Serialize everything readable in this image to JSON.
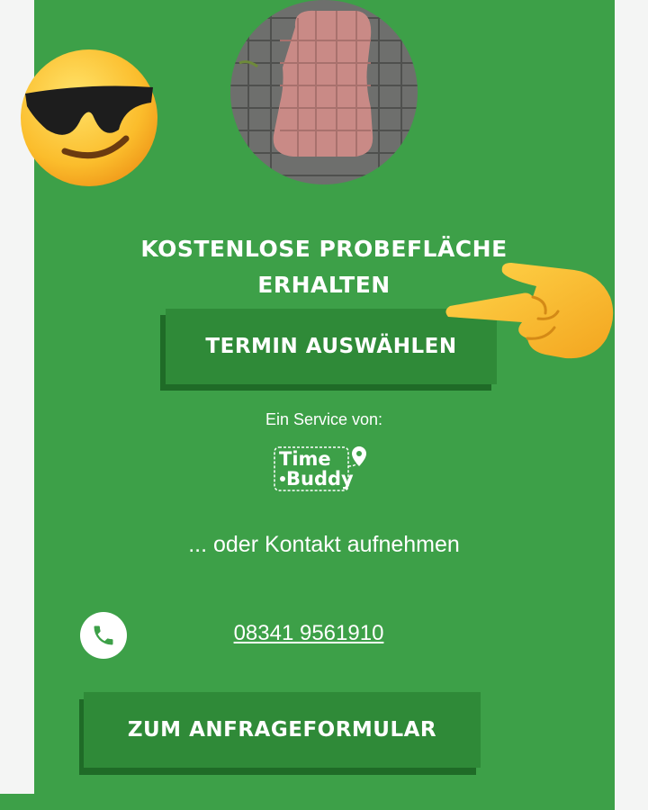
{
  "headline": {
    "line1": "KOSTENLOSE PROBEFLÄCHE",
    "line2": "ERHALTEN"
  },
  "buttons": {
    "termin_label": "TERMIN AUSWÄHLEN",
    "form_label": "ZUM ANFRAGEFORMULAR"
  },
  "service": {
    "label": "Ein Service von:",
    "logo_time": "Time",
    "logo_buddy": "Buddy"
  },
  "contact": {
    "label": "... oder Kontakt aufnehmen",
    "phone": "08341 9561910"
  },
  "icons": {
    "cool_emoji": "smiling-face-with-sunglasses-icon",
    "pointing_hand": "pointing-hand-icon",
    "phone": "phone-icon",
    "logo_pin": "map-pin-icon"
  },
  "colors": {
    "panel_green": "#3da048",
    "button_green": "#2f8a38",
    "button_shadow": "#1f6b27",
    "text": "#ffffff"
  }
}
